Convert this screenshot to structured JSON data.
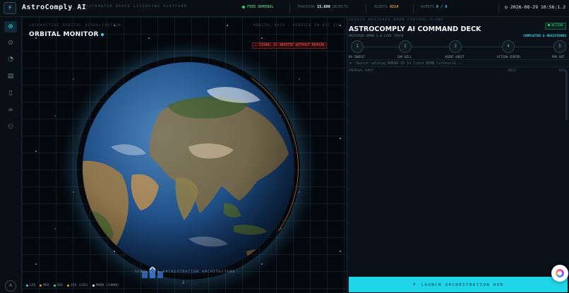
{
  "app": {
    "name": "AstroComply AI",
    "subtitle": "AUTOMATED SPACE LICENSING PLATFORM"
  },
  "topbar": {
    "feed_status": "FEED NOMINAL",
    "tracking_label": "TRACKING",
    "tracking_value": "15,680",
    "tracking_unit": "OBJECTS",
    "alerts_label": "ALERTS",
    "alerts_value": "4214",
    "agents_label": "AGENTS",
    "agents_value": "8 / 8",
    "datetime": "2026-08-29 10:56:1.2"
  },
  "orbital": {
    "kicker": "INTERACTIVE ORBITAL VISUALIZATION",
    "title": "ORBITAL MONITOR",
    "meta": "ORBITAL DATA · UPDATED IN UTC 3LO",
    "alert": "SIGNAL IS ABORTED WITHOUT REASON",
    "arch_label": "SCROLL TO ORCHESTRATION ARCHITECTURE",
    "legend": [
      {
        "label": "LEO",
        "color": "#38d6ea"
      },
      {
        "label": "MEO",
        "color": "#f0a030"
      },
      {
        "label": "GEO",
        "color": "#35e28c"
      },
      {
        "label": "ISS (LEO)",
        "color": "#f0a030"
      },
      {
        "label": "MOON (LUNAR)",
        "color": "#ffffff"
      }
    ]
  },
  "deck": {
    "kicker": "SEARCH MASTERED BPMN CONTROL PLANE",
    "title": "ASTROCOMPLY AI COMMAND DECK",
    "status_pill": "ACTIVE",
    "subtitle": "MASTERED BPMN 2.0 LIVE TRACK",
    "status": "COMPLETED & REGISTERED",
    "steps": [
      {
        "num": "1",
        "label": "RV INGEST"
      },
      {
        "num": "2",
        "label": "SAP BILL"
      },
      {
        "num": "3",
        "label": "AGENT AUDIT"
      },
      {
        "num": "4",
        "label": "ACTION CENTER"
      },
      {
        "num": "5",
        "label": "RPA BOT"
      }
    ],
    "search_placeholder": "Search catalog NORAD ID to trace BPMN lifecycle...",
    "columns": [
      "PROPOSAL AUDIT",
      "INGST",
      "RISK"
    ],
    "launch_label": "LAUNCH ORCHESTRATION HUB"
  },
  "icons": {
    "sidebar": [
      "globe-icon",
      "satellite-icon",
      "gauge-icon",
      "book-icon",
      "document-icon",
      "link-icon",
      "network-icon"
    ],
    "accent": "#38d6ea"
  }
}
